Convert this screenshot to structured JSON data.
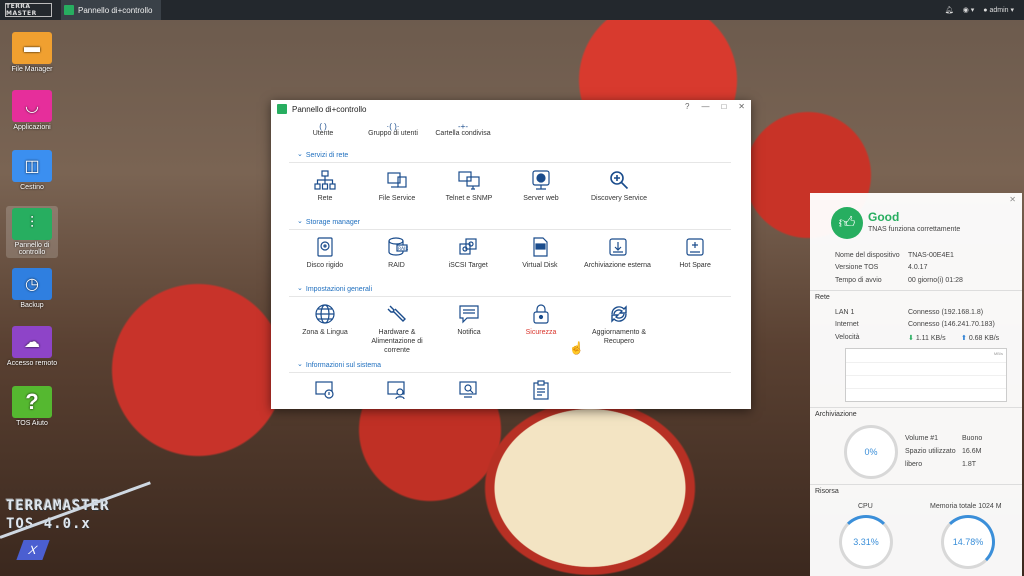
{
  "taskbar": {
    "logo": "TERRA MASTER",
    "app_label": "Pannello di+controllo",
    "user": "admin"
  },
  "desktop": {
    "icons": [
      {
        "label": "File Manager",
        "color": "#f0a030",
        "glyph": "▬"
      },
      {
        "label": "Applicazioni",
        "color": "#e62e9b",
        "glyph": "◡"
      },
      {
        "label": "Cestino",
        "color": "#3b8ff0",
        "glyph": "◫"
      },
      {
        "label": "Pannello di controllo",
        "color": "#27ae60",
        "glyph": "⫶"
      },
      {
        "label": "Backup",
        "color": "#2f7fe0",
        "glyph": "◷"
      },
      {
        "label": "Accesso remoto",
        "color": "#8e44c8",
        "glyph": "☁"
      },
      {
        "label": "TOS Aiuto",
        "color": "#55b830",
        "glyph": "?"
      }
    ],
    "brand_line1": "TERRAMASTER",
    "brand_line2": "TOS 4.0.x",
    "brand_badge": "X"
  },
  "window": {
    "title": "Pannello di+controllo",
    "controls": [
      "?",
      "—",
      "□",
      "✕"
    ],
    "top_row": [
      "Utente",
      "Gruppo di utenti",
      "Cartella condivisa"
    ],
    "sections": [
      {
        "title": "Servizi di rete",
        "items": [
          "Rete",
          "File Service",
          "Telnet e SNMP",
          "Server web",
          "Discovery Service"
        ]
      },
      {
        "title": "Storage manager",
        "items": [
          "Disco rigido",
          "RAID",
          "iSCSI Target",
          "Virtual Disk",
          "Archiviazione esterna",
          "Hot Spare"
        ]
      },
      {
        "title": "Impostazioni generali",
        "items": [
          "Zona & Lingua",
          "Hardware & Alimentazione di corrente",
          "Notifica",
          "Sicurezza",
          "Aggiornamento & Recupero"
        ]
      },
      {
        "title": "Informazioni sul sistema",
        "items": [
          "",
          "",
          "",
          ""
        ]
      }
    ]
  },
  "widget": {
    "status": "Good",
    "status_sub": "TNAS funziona correttamente",
    "info": [
      {
        "k": "Nome del dispositivo",
        "v": "TNAS-00E4E1"
      },
      {
        "k": "Versione TOS",
        "v": "4.0.17"
      },
      {
        "k": "Tempo di avvio",
        "v": "00 giorno(i) 01:28"
      }
    ],
    "rete_title": "Rete",
    "rete": [
      {
        "k": "LAN 1",
        "v": "Connesso (192.168.1.8)"
      },
      {
        "k": "Internet",
        "v": "Connesso (146.241.70.183)"
      }
    ],
    "velocita_label": "Velocità",
    "down_speed": "1.11 KB/s",
    "up_speed": "0.68 KB/s",
    "graph_unit": "MB/s",
    "archiviazione_title": "Archiviazione",
    "storage_pct": "0%",
    "storage": [
      {
        "k": "Volume #1",
        "v": "Buono"
      },
      {
        "k": "Spazio utilizzato",
        "v": "16.6M"
      },
      {
        "k": "libero",
        "v": "1.8T"
      }
    ],
    "risorsa_title": "Risorsa",
    "cpu_label": "CPU",
    "cpu_pct": "3.31%",
    "mem_label": "Memoria totale 1024 M",
    "mem_pct": "14.78%",
    "colors": {
      "good": "#27ae60",
      "accent": "#3b8fd9"
    }
  }
}
